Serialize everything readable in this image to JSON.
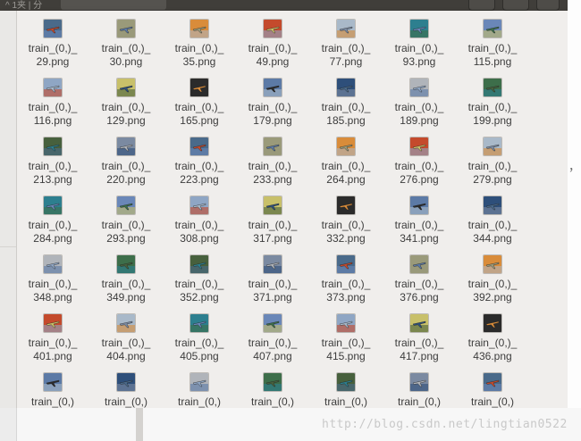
{
  "titlebar": {
    "label": "^ 1夹 | 分"
  },
  "watermark": "http://blog.csdn.net/lingtian0522",
  "stray_mark": "，",
  "thumb_palette": [
    "#2b2b2b",
    "#6a87b8",
    "#c44a2c",
    "#4a6a8a",
    "#3d6e4a",
    "#5c7aa6",
    "#8fa6c4",
    "#a9b9c9",
    "#9a9a7a",
    "#47603d",
    "#2e4f7a",
    "#c8c06a",
    "#2d7f8f",
    "#d98c3a",
    "#7b8aa1",
    "#b0b4ba"
  ],
  "files": [
    {
      "l1": "train_(0,)_",
      "l2": "29.png"
    },
    {
      "l1": "train_(0,)_",
      "l2": "30.png"
    },
    {
      "l1": "train_(0,)_",
      "l2": "35.png"
    },
    {
      "l1": "train_(0,)_",
      "l2": "49.png"
    },
    {
      "l1": "train_(0,)_",
      "l2": "77.png"
    },
    {
      "l1": "train_(0,)_",
      "l2": "93.png"
    },
    {
      "l1": "train_(0,)_",
      "l2": "115.png"
    },
    {
      "l1": "train_(0,)_",
      "l2": "116.png"
    },
    {
      "l1": "train_(0,)_",
      "l2": "129.png"
    },
    {
      "l1": "train_(0,)_",
      "l2": "165.png"
    },
    {
      "l1": "train_(0,)_",
      "l2": "179.png"
    },
    {
      "l1": "train_(0,)_",
      "l2": "185.png"
    },
    {
      "l1": "train_(0,)_",
      "l2": "189.png"
    },
    {
      "l1": "train_(0,)_",
      "l2": "199.png"
    },
    {
      "l1": "train_(0,)_",
      "l2": "213.png"
    },
    {
      "l1": "train_(0,)_",
      "l2": "220.png"
    },
    {
      "l1": "train_(0,)_",
      "l2": "223.png"
    },
    {
      "l1": "train_(0,)_",
      "l2": "233.png"
    },
    {
      "l1": "train_(0,)_",
      "l2": "264.png"
    },
    {
      "l1": "train_(0,)_",
      "l2": "276.png"
    },
    {
      "l1": "train_(0,)_",
      "l2": "279.png"
    },
    {
      "l1": "train_(0,)_",
      "l2": "284.png"
    },
    {
      "l1": "train_(0,)_",
      "l2": "293.png"
    },
    {
      "l1": "train_(0,)_",
      "l2": "308.png"
    },
    {
      "l1": "train_(0,)_",
      "l2": "317.png"
    },
    {
      "l1": "train_(0,)_",
      "l2": "332.png"
    },
    {
      "l1": "train_(0,)_",
      "l2": "341.png"
    },
    {
      "l1": "train_(0,)_",
      "l2": "344.png"
    },
    {
      "l1": "train_(0,)_",
      "l2": "348.png"
    },
    {
      "l1": "train_(0,)_",
      "l2": "349.png"
    },
    {
      "l1": "train_(0,)_",
      "l2": "352.png"
    },
    {
      "l1": "train_(0,)_",
      "l2": "371.png"
    },
    {
      "l1": "train_(0,)_",
      "l2": "373.png"
    },
    {
      "l1": "train_(0,)_",
      "l2": "376.png"
    },
    {
      "l1": "train_(0,)_",
      "l2": "392.png"
    },
    {
      "l1": "train_(0,)_",
      "l2": "401.png"
    },
    {
      "l1": "train_(0,)_",
      "l2": "404.png"
    },
    {
      "l1": "train_(0,)_",
      "l2": "405.png"
    },
    {
      "l1": "train_(0,)_",
      "l2": "407.png"
    },
    {
      "l1": "train_(0,)_",
      "l2": "415.png"
    },
    {
      "l1": "train_(0,)_",
      "l2": "417.png"
    },
    {
      "l1": "train_(0,)_",
      "l2": "436.png"
    },
    {
      "l1": "train_(0,)",
      "l2": ""
    },
    {
      "l1": "train_(0,)",
      "l2": ""
    },
    {
      "l1": "train_(0,)",
      "l2": ""
    },
    {
      "l1": "train_(0,)",
      "l2": ""
    },
    {
      "l1": "train_(0,)",
      "l2": ""
    },
    {
      "l1": "train_(0,)",
      "l2": ""
    },
    {
      "l1": "train_(0,)",
      "l2": ""
    }
  ]
}
